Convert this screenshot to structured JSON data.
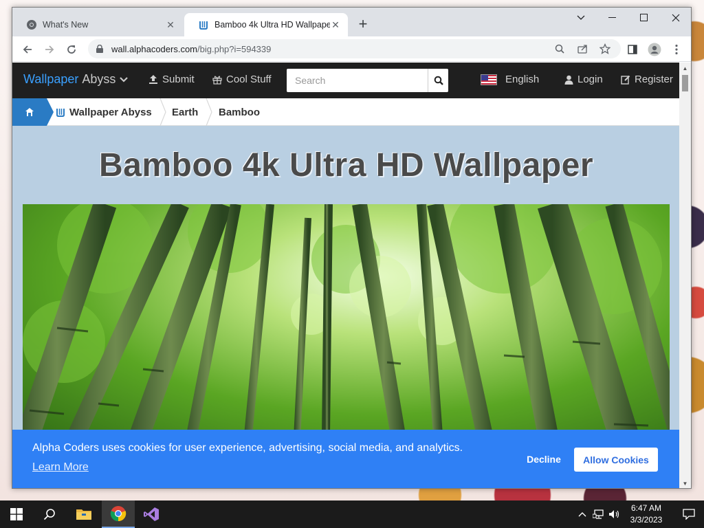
{
  "browser": {
    "tabs": [
      {
        "title": "What's New",
        "icon": "chrome-icon",
        "active": false
      },
      {
        "title": "Bamboo 4k Ultra HD Wallpaper",
        "icon": "wallpaper-abyss-icon",
        "active": true
      }
    ],
    "url": {
      "host": "wall.alphacoders.com",
      "path": "/big.php?i=594339"
    }
  },
  "site": {
    "brand_main": "Wallpaper",
    "brand_sub": "Abyss",
    "nav": {
      "submit": "Submit",
      "cool_stuff": "Cool Stuff",
      "language": "English",
      "login": "Login",
      "register": "Register"
    },
    "search": {
      "placeholder": "Search"
    },
    "breadcrumbs": [
      "Wallpaper Abyss",
      "Earth",
      "Bamboo"
    ],
    "page_title": "Bamboo 4k Ultra HD Wallpaper",
    "colors": {
      "brand_blue": "#3aa0ff",
      "nav_bg": "#1f1f1f",
      "cookie_bg": "#2f80f5",
      "crumb_home": "#2a7bc4"
    }
  },
  "cookie": {
    "message": "Alpha Coders uses cookies for user experience, advertising, social media, and analytics.",
    "learn_more": "Learn More",
    "decline": "Decline",
    "allow": "Allow Cookies"
  },
  "taskbar": {
    "time": "6:47 AM",
    "date": "3/3/2023",
    "apps": [
      "start-icon",
      "search-icon",
      "file-explorer-icon",
      "chrome-icon",
      "visual-studio-icon"
    ]
  }
}
